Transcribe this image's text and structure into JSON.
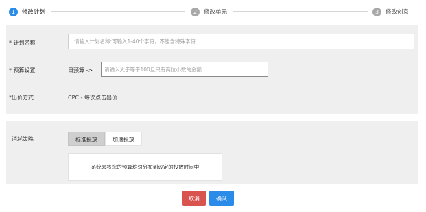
{
  "stepper": {
    "steps": [
      {
        "num": "1",
        "label": "修改计划"
      },
      {
        "num": "2",
        "label": "修改单元"
      },
      {
        "num": "3",
        "label": "修改创意"
      }
    ]
  },
  "form": {
    "plan_name": {
      "label": "* 计划名称",
      "placeholder": "请输入计划名称:可输入1-40个字符，不能含特殊字符",
      "value": ""
    },
    "budget": {
      "label": "* 预算设置",
      "prefix": "日预算 ->",
      "placeholder": "请输入大于等于100且只有两位小数的金额",
      "value": ""
    },
    "bid": {
      "label": "*出价方式",
      "value": "CPC - 每次点击出价"
    }
  },
  "strategy": {
    "label": "消耗策略",
    "tabs": [
      "标准投放",
      "加速投放"
    ],
    "selected": "标准投放",
    "description": "系统会将您的预算均匀分布到设定的投放时间中"
  },
  "actions": {
    "cancel_label": "取消",
    "confirm_label": "确认"
  },
  "colors": {
    "accent": "#2a8ce8",
    "danger": "#d9534f",
    "inactive_step": "#a8a8a8",
    "panel_bg": "#efefef"
  }
}
